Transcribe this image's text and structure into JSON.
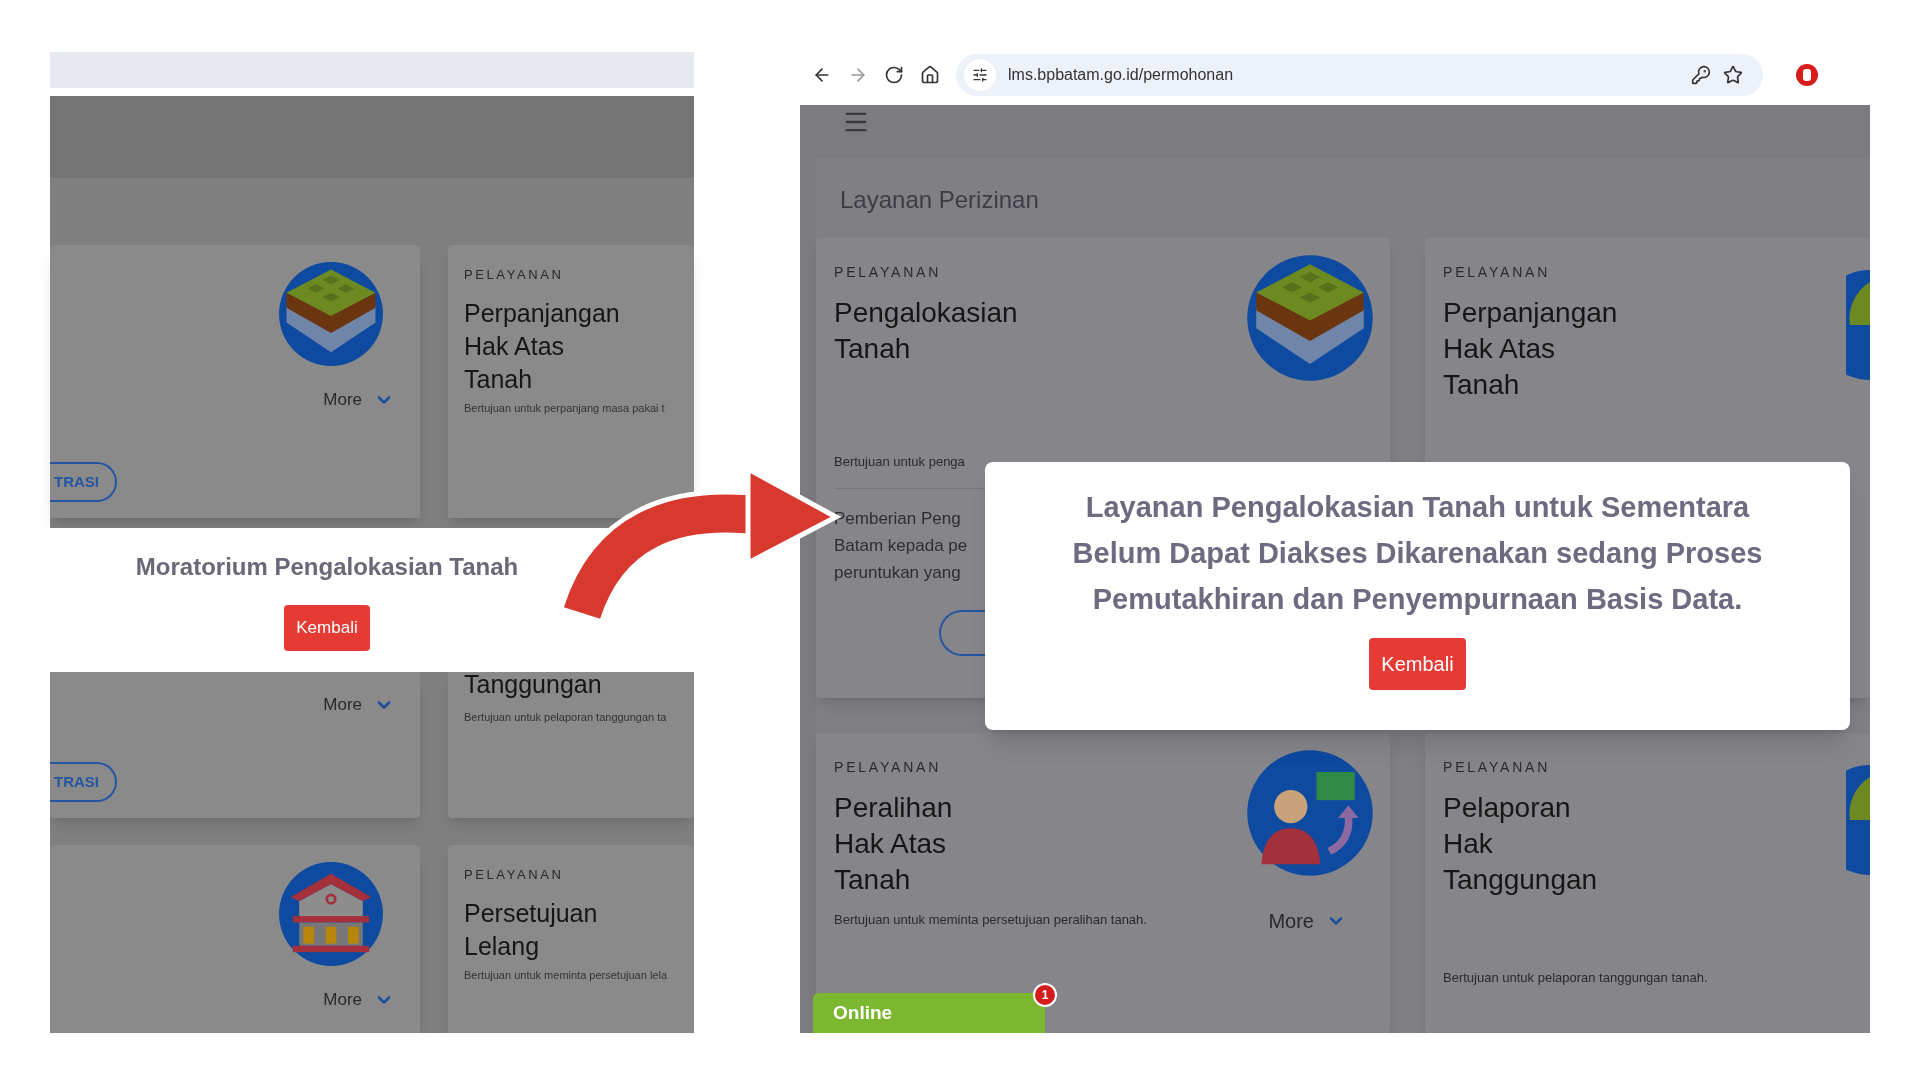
{
  "left_screenshot": {
    "top_row": {
      "left_card": {
        "more": "More",
        "outline_button": "TRASI"
      },
      "right_card": {
        "label": "PELAYANAN",
        "title_lines": [
          "Perpanjangan",
          "Hak Atas",
          "Tanah"
        ],
        "description": "Bertujuan untuk perpanjang masa pakai t"
      }
    },
    "notice": {
      "title": "Moratorium Pengalokasian Tanah",
      "button": "Kembali"
    },
    "middle_row": {
      "left_card": {
        "more": "More",
        "outline_button": "TRASI"
      },
      "right_card": {
        "title_lines": [
          "Tanggungan"
        ],
        "description": "Bertujuan untuk pelaporan tanggungan ta"
      }
    },
    "bottom_row": {
      "left_card": {
        "more": "More"
      },
      "right_card": {
        "label": "PELAYANAN",
        "title_lines": [
          "Persetujuan",
          "Lelang"
        ],
        "description": "Bertujuan untuk meminta persetujuan lela"
      }
    }
  },
  "right_screenshot": {
    "browser": {
      "url": "lms.bpbatam.go.id/permohonan"
    },
    "section_title": "Layanan Perizinan",
    "cards": [
      {
        "label": "PELAYANAN",
        "title_lines": [
          "Pengalokasian",
          "Tanah"
        ],
        "description": "Bertujuan untuk penga",
        "body_lines": [
          "Pemberian Peng",
          "Batam kepada pe",
          "peruntukan yang"
        ]
      },
      {
        "label": "PELAYANAN",
        "title_lines": [
          "Perpanjangan",
          "Hak Atas",
          "Tanah"
        ]
      },
      {
        "label": "PELAYANAN",
        "title_lines": [
          "Peralihan",
          "Hak Atas",
          "Tanah"
        ],
        "description": "Bertujuan untuk meminta persetujuan peralihan tanah.",
        "more": "More"
      },
      {
        "label": "PELAYANAN",
        "title_lines": [
          "Pelaporan",
          "Hak",
          "Tanggungan"
        ],
        "description": "Bertujuan untuk pelaporan tanggungan tanah."
      }
    ],
    "modal": {
      "message_lines": [
        "Layanan Pengalokasian Tanah untuk Sementara",
        "Belum Dapat Diakses Dikarenakan sedang Proses",
        "Pemutakhiran dan Penyempurnaan Basis Data."
      ],
      "button": "Kembali"
    },
    "chat_widget": {
      "label": "Online",
      "count": "1"
    }
  }
}
